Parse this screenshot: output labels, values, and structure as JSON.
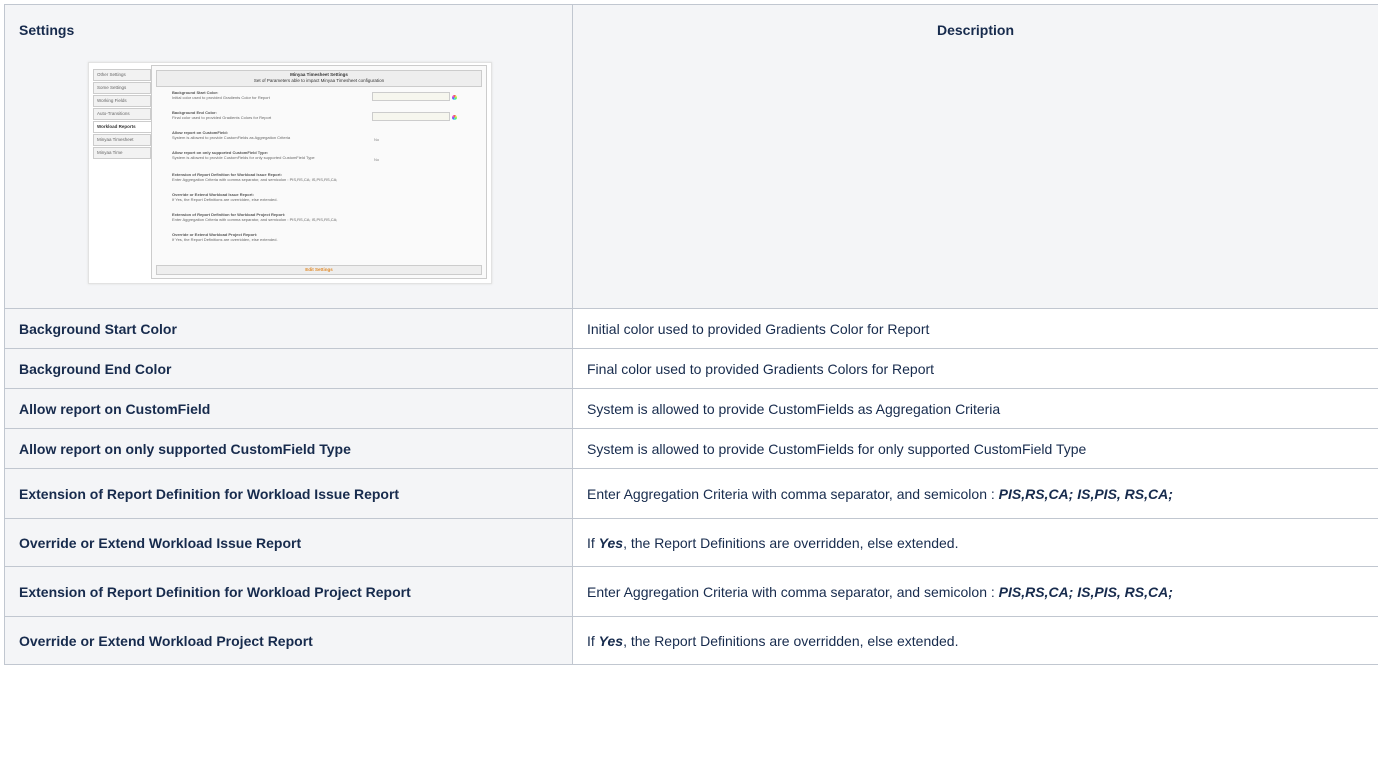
{
  "table": {
    "header_settings": "Settings",
    "header_description": "Description"
  },
  "thumbnail": {
    "nav": [
      "Other Settings",
      "Some Settings",
      "Working Fields",
      "Auto-Transitions",
      "Workload Reports",
      "Minyaa Timesheet",
      "Minyaa Time"
    ],
    "active_nav": "Workload Reports",
    "panel_title": "Minyaa Timesheet Settings",
    "panel_subtitle": "Set of Parameters able to impact Minyaa Timesheet configuration",
    "items": [
      {
        "title": "Background Start Color:",
        "desc": "Initial color used to provided Gradients Color for Report"
      },
      {
        "title": "Background End Color:",
        "desc": "Final color used to provided Gradients Colors for Report"
      },
      {
        "title": "Allow report on CustomField:",
        "desc": "System is allowed to provide CustomFields as Aggregation Criteria",
        "value": "No"
      },
      {
        "title": "Allow report on only supported CustomField Type:",
        "desc": "System is allowed to provide CustomFields for only supported CustomField Type",
        "value": "No"
      },
      {
        "title": "Extension of Report Definition for Workload Issue Report:",
        "desc": "Enter Aggregation Criteria with comma separator, and semicolon : PIS,RS,CA; IS,PIS,RS,CA;"
      },
      {
        "title": "Override or Extend Workload Issue Report:",
        "desc": "If Yes, the Report Definitions are overridden, else extended."
      },
      {
        "title": "Extension of Report Definition for Workload Project Report:",
        "desc": "Enter Aggregation Criteria with comma separator, and semicolon : PIS,RS,CA; IS,PIS,RS,CA;"
      },
      {
        "title": "Override or Extend Workload Project Report:",
        "desc": "If Yes, the Report Definitions are overridden, else extended."
      }
    ],
    "edit_button": "Edit Settings"
  },
  "rows": [
    {
      "label": "Background Start Color",
      "description": "Initial color used to provided Gradients Color for Report"
    },
    {
      "label": "Background End Color",
      "description": "Final color used to provided Gradients Colors for Report"
    },
    {
      "label": "Allow report on CustomField",
      "description": "System is allowed to provide CustomFields as Aggregation Criteria"
    },
    {
      "label": "Allow report on only supported CustomField Type",
      "description": "System is allowed to provide CustomFields for only supported CustomField Type"
    },
    {
      "label": "Extension of Report Definition for Workload Issue Report",
      "desc_prefix": "Enter Aggregation Criteria with comma separator, and semicolon : ",
      "desc_emphasis": "PIS,RS,CA; IS,PIS, RS,CA;"
    },
    {
      "label": "Override or Extend Workload Issue Report",
      "desc_pre": "If ",
      "desc_emphasis": "Yes",
      "desc_post": ", the Report Definitions are overridden, else extended."
    },
    {
      "label": "Extension of Report Definition for Workload Project Report",
      "desc_prefix": "Enter Aggregation Criteria with comma separator, and semicolon : ",
      "desc_emphasis": "PIS,RS,CA; IS,PIS, RS,CA;"
    },
    {
      "label": "Override or Extend Workload Project Report",
      "desc_pre": "If ",
      "desc_emphasis": "Yes",
      "desc_post": ", the Report Definitions are overridden, else extended."
    }
  ]
}
